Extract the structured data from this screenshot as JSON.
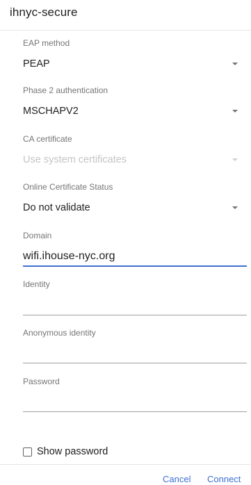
{
  "dialog": {
    "title": "ihnyc-secure"
  },
  "fields": {
    "eap_method": {
      "label": "EAP method",
      "value": "PEAP"
    },
    "phase2": {
      "label": "Phase 2 authentication",
      "value": "MSCHAPV2"
    },
    "ca_certificate": {
      "label": "CA certificate",
      "value": "Use system certificates",
      "disabled": true
    },
    "ocsp": {
      "label": "Online Certificate Status",
      "value": "Do not validate"
    },
    "domain": {
      "label": "Domain",
      "value": "wifi.ihouse-nyc.org"
    },
    "identity": {
      "label": "Identity",
      "value": ""
    },
    "anonymous_identity": {
      "label": "Anonymous identity",
      "value": ""
    },
    "password": {
      "label": "Password",
      "value": ""
    }
  },
  "show_password": {
    "label": "Show password",
    "checked": false
  },
  "buttons": {
    "cancel": "Cancel",
    "connect": "Connect"
  },
  "colors": {
    "accent": "#3f6fd1",
    "label": "#757575",
    "text": "#212121"
  }
}
